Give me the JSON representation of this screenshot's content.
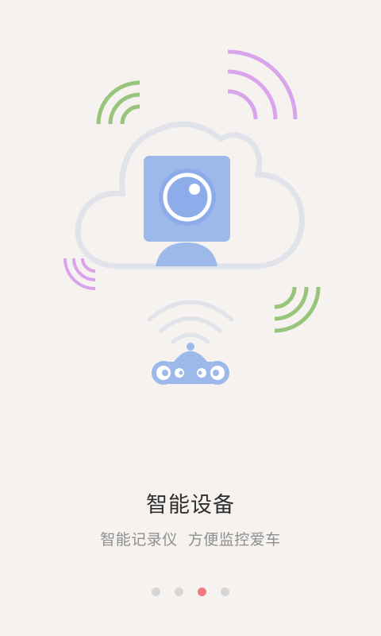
{
  "intro": {
    "title": "智能设备",
    "subtitle": "智能记录仪  方便监控爱车"
  },
  "illustration": {
    "cloud_icon": "cloud-icon",
    "camera_icon": "camera-icon",
    "car_icon": "car-icon",
    "wifi_icon": "wifi-icon",
    "signal_icon": "signal-wave-icon"
  },
  "pager": {
    "total": 4,
    "active_index": 2
  },
  "colors": {
    "background": "#f5f2ef",
    "cloud_outline": "#e1e3ea",
    "camera_blue": "#9db9ea",
    "green_wave": "#99c47c",
    "purple_wave": "#d9a4ec",
    "dot_active": "#f07b83",
    "dot_inactive": "#d6d6d6"
  }
}
